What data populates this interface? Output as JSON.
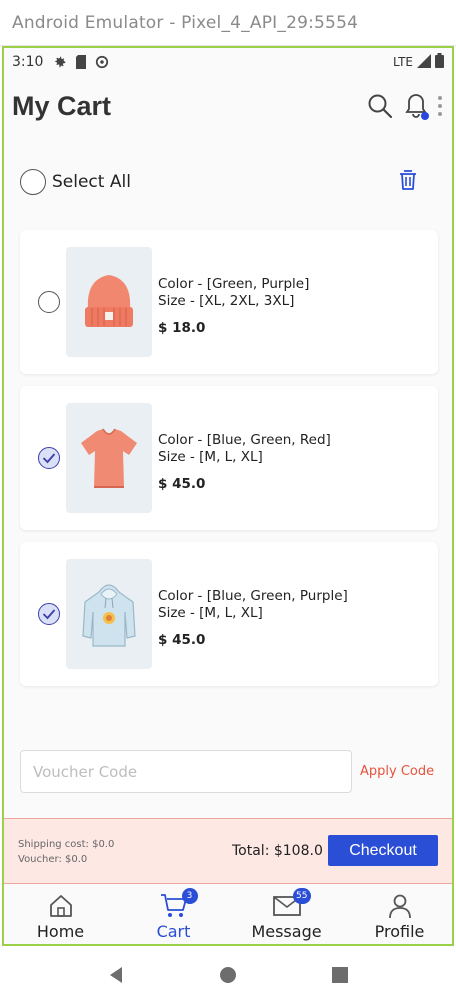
{
  "window": {
    "title": "Android Emulator - Pixel_4_API_29:5554"
  },
  "status_bar": {
    "time": "3:10",
    "network": "LTE"
  },
  "app_bar": {
    "title": "My Cart"
  },
  "select_all": {
    "label": "Select All",
    "checked": false
  },
  "cart_items": [
    {
      "color": "Color - [Green, Purple]",
      "size": "Size - [XL, 2XL, 3XL]",
      "price": "$ 18.0",
      "checked": false,
      "product": "beanie"
    },
    {
      "color": "Color - [Blue, Green, Red]",
      "size": "Size - [M, L, XL]",
      "price": "$ 45.0",
      "checked": true,
      "product": "t-shirt"
    },
    {
      "color": "Color - [Blue, Green, Purple]",
      "size": "Size - [M, L, XL]",
      "price": "$ 45.0",
      "checked": true,
      "product": "hoodie"
    }
  ],
  "voucher": {
    "placeholder": "Voucher Code",
    "value": "",
    "apply_label": "Apply Code"
  },
  "summary": {
    "shipping": "Shipping cost: $0.0",
    "voucher": "Voucher: $0.0",
    "total": "Total: $108.0",
    "checkout_label": "Checkout"
  },
  "bottom_nav": {
    "home": {
      "label": "Home"
    },
    "cart": {
      "label": "Cart",
      "badge": "3"
    },
    "message": {
      "label": "Message",
      "badge": "55"
    },
    "profile": {
      "label": "Profile"
    }
  },
  "colors": {
    "accent": "#2b4ed6",
    "apply_code": "#e5533d",
    "summary_bg": "#fde8e4",
    "device_frame": "#9bd14a"
  }
}
